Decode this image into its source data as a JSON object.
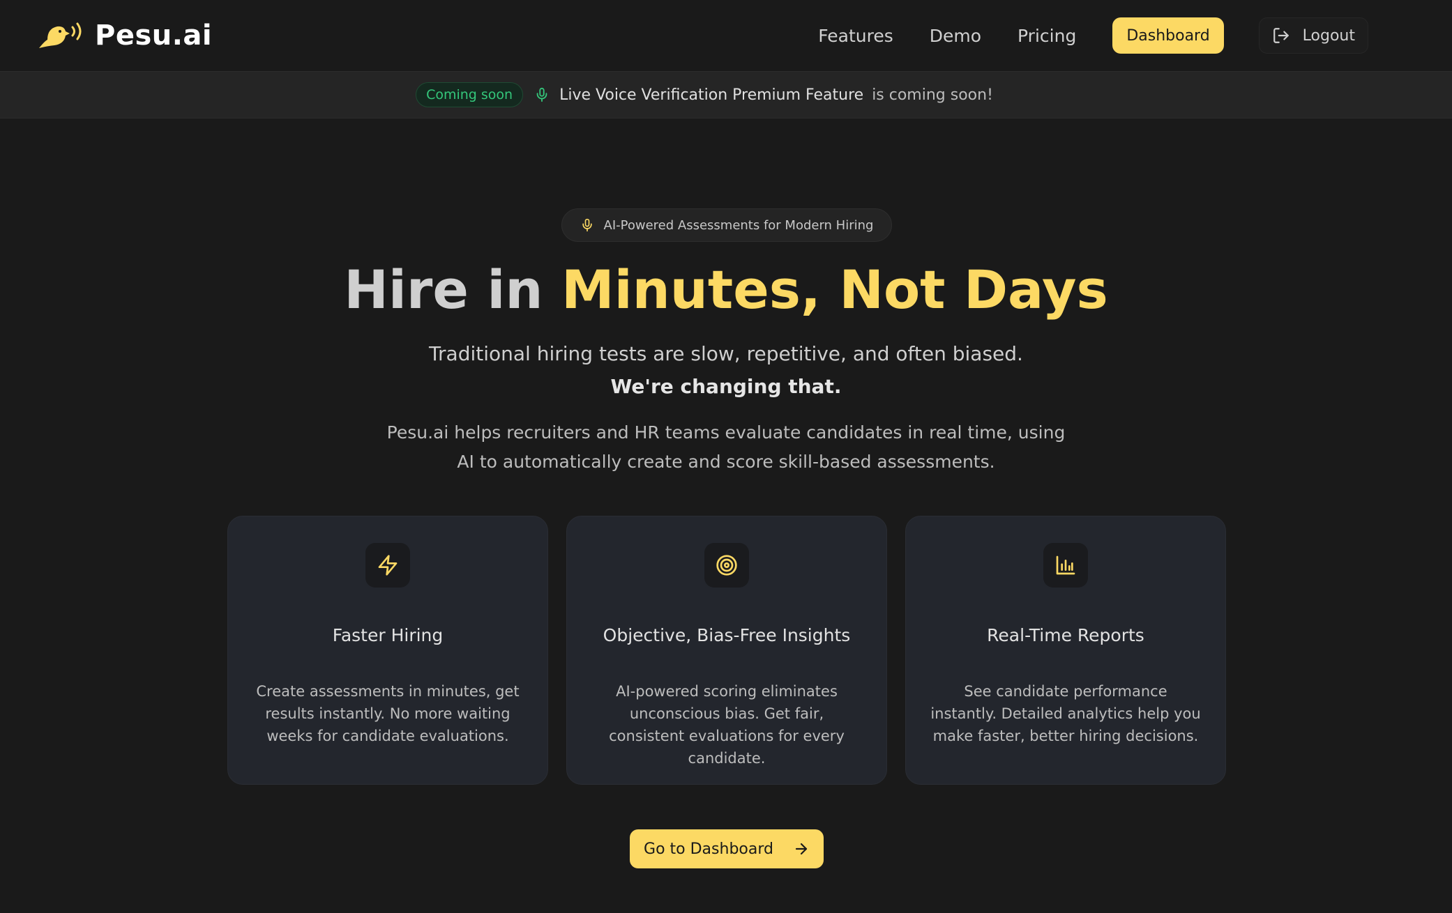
{
  "brand": {
    "name": "Pesu.ai",
    "logo_icon": "bird-sound-icon"
  },
  "nav": {
    "links": [
      "Features",
      "Demo",
      "Pricing"
    ],
    "dashboard_label": "Dashboard",
    "logout_label": "Logout"
  },
  "announcement": {
    "badge": "Coming soon",
    "feature": "Live Voice Verification Premium Feature",
    "tail": "is coming soon!"
  },
  "hero": {
    "pill": "AI-Powered Assessments for Modern Hiring",
    "headline_plain": "Hire in",
    "headline_accent": "Minutes, Not Days",
    "sub1_plain": "Traditional hiring tests are slow, repetitive, and often biased.",
    "sub1_bold": "We're changing that.",
    "sub2": "Pesu.ai helps recruiters and HR teams evaluate candidates in real time, using AI to automatically create and score skill-based assessments."
  },
  "cards": [
    {
      "icon": "lightning-icon",
      "title": "Faster Hiring",
      "desc": "Create assessments in minutes, get results instantly. No more waiting weeks for candidate evaluations."
    },
    {
      "icon": "target-icon",
      "title": "Objective, Bias-Free Insights",
      "desc": "AI-powered scoring eliminates unconscious bias. Get fair, consistent evaluations for every candidate."
    },
    {
      "icon": "bar-chart-icon",
      "title": "Real-Time Reports",
      "desc": "See candidate performance instantly. Detailed analytics help you make faster, better hiring decisions."
    }
  ],
  "cta": {
    "label": "Go to Dashboard"
  },
  "colors": {
    "accent": "#fcd964",
    "background": "#1a1a1a",
    "card": "#23262d",
    "success": "#34c77b"
  }
}
